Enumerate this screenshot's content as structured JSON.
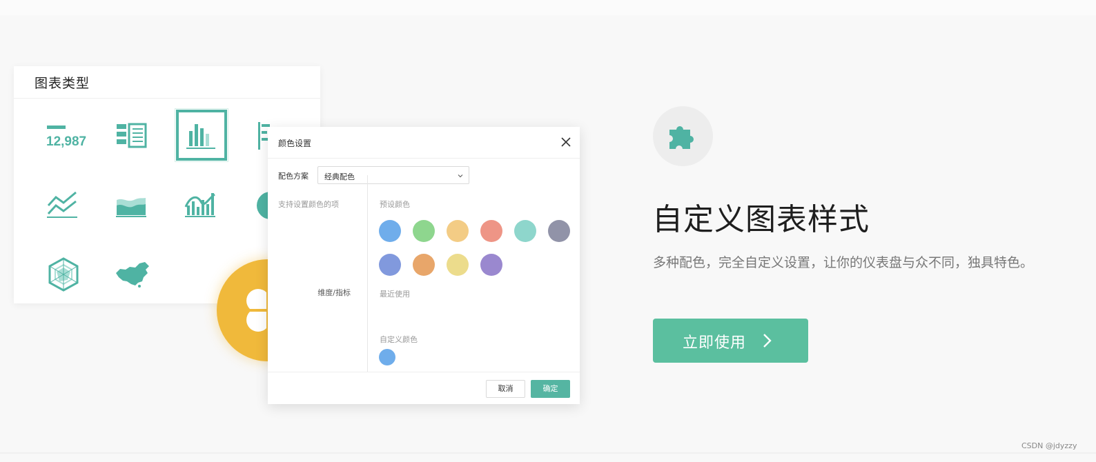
{
  "chart_type_panel": {
    "title": "图表类型",
    "kpi_value": "12,987",
    "icons": [
      "kpi-number-icon",
      "table-list-icon",
      "bar-chart-icon",
      "bar-list-icon",
      "line-chart-icon",
      "area-chart-icon",
      "combo-chart-icon",
      "pie-chart-icon",
      "radar-chart-icon",
      "china-map-icon"
    ],
    "selected_icon": "bar-chart-icon"
  },
  "color_dialog": {
    "title": "颜色设置",
    "scheme_label": "配色方案",
    "scheme_value": "经典配色",
    "left_header": "支持设置颜色的项",
    "left_item": "维度/指标",
    "preset_label": "预设颜色",
    "preset_colors": [
      "#6fadeb",
      "#8ed68e",
      "#f3cc85",
      "#ee9586",
      "#8ed6cc",
      "#9193a8",
      "#8199dd",
      "#e8a66a",
      "#ecdc8c",
      "#9a88cf"
    ],
    "recent_label": "最近使用",
    "custom_label": "自定义颜色",
    "custom_colors": [
      "#6fadeb"
    ],
    "cancel_label": "取消",
    "ok_label": "确定"
  },
  "feature": {
    "title": "自定义图表样式",
    "description": "多种配色，完全自定义设置，让你的仪表盘与众不同，独具特色。",
    "cta_label": "立即使用"
  },
  "watermark": "CSDN @jdyzzy",
  "colors": {
    "accent": "#55b5a2",
    "cta": "#5bbf9f",
    "badge": "#f0b93b",
    "teal_icon": "#4fb3a3"
  }
}
